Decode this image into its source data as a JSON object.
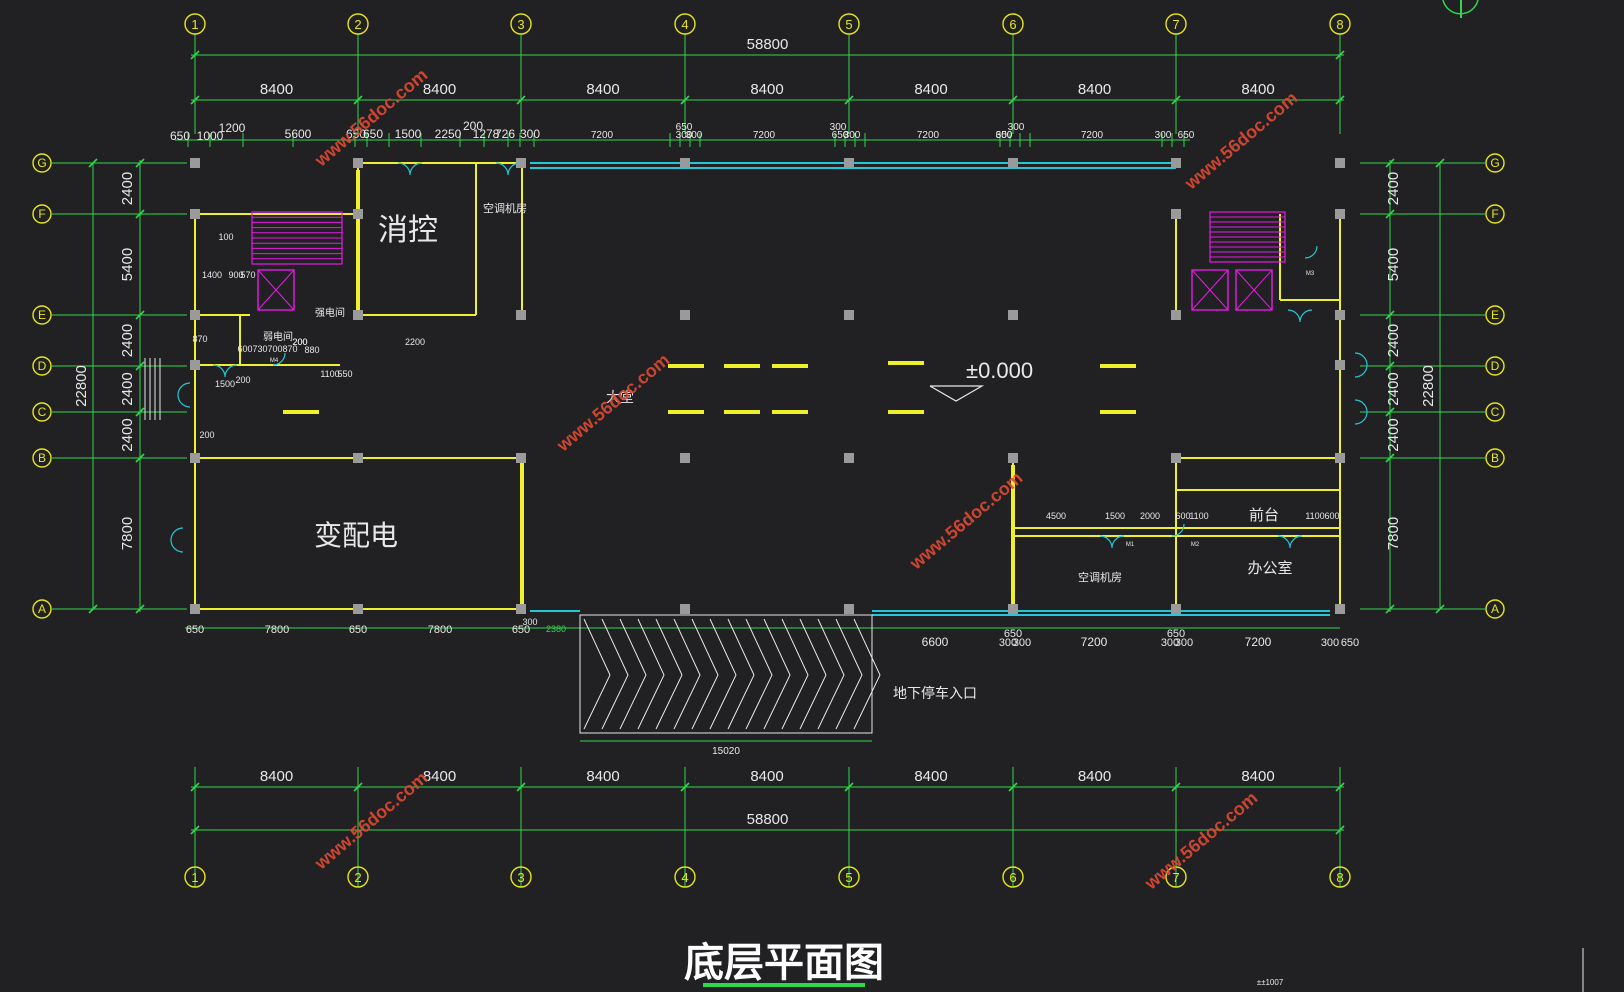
{
  "drawing": {
    "title": "底层平面图",
    "floor_level": "±0.000",
    "watermark": "www.56doc.com",
    "footer_note": "±±1007",
    "overall_length": "58800",
    "overall_width": "22800"
  },
  "colors": {
    "background": "#212124",
    "axis": "#e6e61a",
    "dimension": "#2fd84a",
    "wall": "#f0f02a",
    "column": "#9a9a9a",
    "glazing": "#25c7d6",
    "stair": "#e61ae6",
    "text": "#e8e8e8",
    "watermark": "#e04a32"
  },
  "axes": {
    "numbers": [
      "1",
      "2",
      "3",
      "4",
      "5",
      "6",
      "7",
      "8"
    ],
    "letters": [
      "A",
      "B",
      "C",
      "D",
      "E",
      "F",
      "G"
    ]
  },
  "dimensions": {
    "bay_spacings": [
      "8400",
      "8400",
      "8400",
      "8400",
      "8400",
      "8400",
      "8400"
    ],
    "top_detail": [
      "650",
      "1000",
      "1200",
      "5600",
      "650",
      "650",
      "1500",
      "2250",
      "200",
      "1278",
      "726",
      "300",
      "7200",
      "650",
      "300",
      "300",
      "7200",
      "650",
      "300",
      "300",
      "7200",
      "650",
      "300",
      "300",
      "7200",
      "300",
      "650"
    ],
    "left_bays": [
      "2400",
      "5400",
      "2400",
      "2400",
      "2400",
      "7800"
    ],
    "right_bays": [
      "2400",
      "5400",
      "2400",
      "2400",
      "2400",
      "7800"
    ],
    "bottom_detail": [
      "650",
      "7800",
      "650",
      "7800",
      "650",
      "300",
      "2380",
      "6600",
      "650",
      "300",
      "300",
      "7200",
      "650",
      "300",
      "300",
      "7200",
      "300",
      "650"
    ],
    "ramp_width": "15020",
    "small_left": [
      "100",
      "1400",
      "900",
      "570",
      "870",
      "600",
      "730",
      "700",
      "870",
      "200",
      "1500",
      "200",
      "200",
      "1100",
      "550",
      "2200",
      "880",
      "200"
    ],
    "small_right": [
      "4500",
      "1500",
      "2000",
      "600",
      "1100",
      "1100",
      "600"
    ]
  },
  "rooms": {
    "fire_control": "消控",
    "ac_room_top": "空调机房",
    "transformer": "变配电",
    "strong_elec": "强电间",
    "weak_elec": "弱电间",
    "ac_room_right": "空调机房",
    "reception": "前台",
    "office": "办公室",
    "parking_entrance": "地下停车入口",
    "hall_label": "大堂"
  },
  "door_tags": {
    "m1": "M1",
    "m2": "M2",
    "m3": "M3",
    "m4": "M4"
  }
}
